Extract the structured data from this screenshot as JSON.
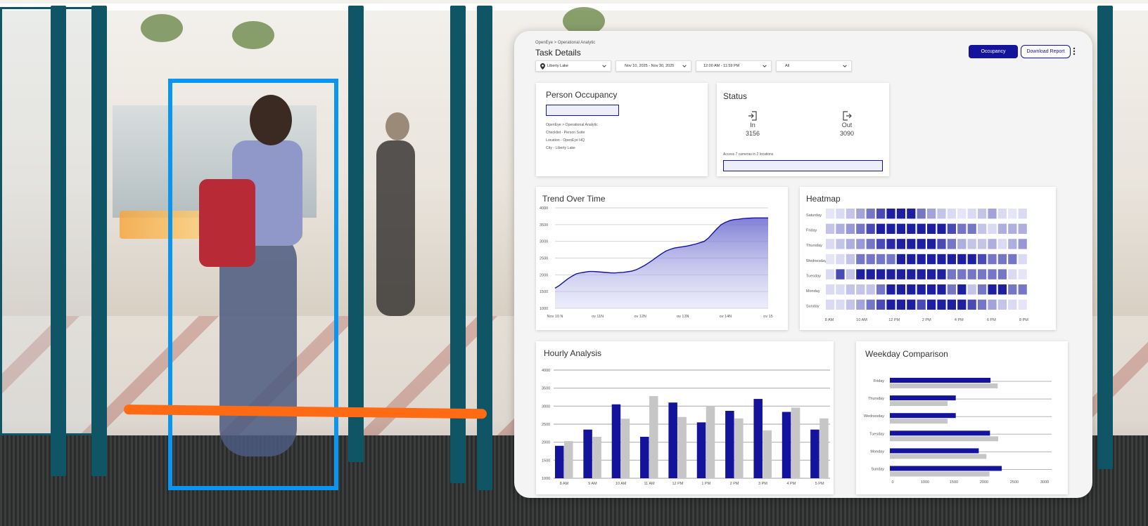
{
  "breadcrumb": "OpenEye  >  Operational Analytic",
  "page_title": "Task Details",
  "filters": {
    "location": "Liberty Lake",
    "date_range": "Nov 10, 2025 - Nov 30, 2025",
    "time_range": "12:00 AM - 11:59 PM",
    "camera": "All"
  },
  "buttons": {
    "occupancy": "Occupancy",
    "download": "Download Report"
  },
  "colors": {
    "accent": "#13139c",
    "detection_box": "#0a95f0",
    "counting_line": "#ff6a14"
  },
  "person_occupancy": {
    "title": "Person Occupancy",
    "lines": [
      "OpenEye  >  Operational Analytic",
      "Checklist - Person Suite",
      "Location - OpenEye HQ",
      "City - Liberty Lake"
    ]
  },
  "status": {
    "title": "Status",
    "in_label": "In",
    "in_value": "3156",
    "out_label": "Out",
    "out_value": "3090",
    "note": "Access 7 cameras in 2 locations"
  },
  "trend": {
    "title": "Trend Over Time",
    "chart_data": {
      "type": "area",
      "x_labels": [
        "Nov 10 N",
        "ov 11N",
        "ov 12N",
        "ov 13N",
        "ov 14N",
        "ov 15"
      ],
      "x": [
        0,
        0.1,
        0.2,
        0.3,
        0.4,
        0.5,
        0.6,
        0.7,
        0.8,
        0.9,
        1.0,
        1.1,
        1.2,
        1.3,
        1.4,
        1.5,
        1.6,
        1.7,
        1.8,
        1.9,
        2.0,
        2.1,
        2.2,
        2.3,
        2.4,
        2.5,
        2.6,
        2.7,
        2.8,
        2.9,
        3.0,
        3.1,
        3.2,
        3.3,
        3.4,
        3.5,
        3.6,
        3.7,
        3.8,
        3.9,
        4.0,
        4.1,
        4.2,
        4.3,
        4.4,
        4.5,
        4.6,
        4.7,
        4.8,
        4.9,
        5.0
      ],
      "y": [
        1600,
        1680,
        1780,
        1880,
        1960,
        2030,
        2060,
        2080,
        2100,
        2100,
        2090,
        2080,
        2070,
        2060,
        2055,
        2065,
        2075,
        2090,
        2110,
        2150,
        2210,
        2280,
        2360,
        2450,
        2540,
        2630,
        2710,
        2760,
        2800,
        2820,
        2840,
        2860,
        2890,
        2920,
        2960,
        3000,
        3100,
        3240,
        3380,
        3500,
        3570,
        3620,
        3650,
        3660,
        3680,
        3690,
        3695,
        3700,
        3700,
        3700,
        3700
      ],
      "y_ticks": [
        1000,
        1500,
        2000,
        2500,
        3000,
        3500,
        4000
      ],
      "ylim": [
        1000,
        4000
      ]
    }
  },
  "heatmap": {
    "title": "Heatmap",
    "chart_data": {
      "type": "heatmap",
      "rows": [
        "Saturday",
        "Friday",
        "Thursday",
        "Wednesday",
        "Tuesday",
        "Monday",
        "Sunday"
      ],
      "x_labels": [
        "8 AM",
        "10 AM",
        "12 PM",
        "2 PM",
        "4 PM",
        "6 PM",
        "8 PM"
      ],
      "values": [
        [
          0.05,
          0.1,
          0.2,
          0.35,
          0.55,
          0.75,
          0.95,
          0.95,
          0.95,
          0.55,
          0.35,
          0.2,
          0.1,
          0.05,
          0.1,
          0.2,
          0.35,
          0.1,
          0.05,
          0.1
        ],
        [
          0.2,
          0.3,
          0.4,
          0.55,
          0.75,
          0.95,
          0.95,
          0.95,
          0.95,
          0.95,
          0.95,
          0.95,
          0.75,
          0.55,
          0.55,
          0.2,
          0.1,
          0.3,
          0.3,
          0.3
        ],
        [
          0.1,
          0.2,
          0.3,
          0.4,
          0.55,
          0.75,
          0.9,
          0.95,
          0.95,
          0.95,
          0.95,
          0.75,
          0.55,
          0.3,
          0.2,
          0.2,
          0.3,
          0.1,
          0.3,
          0.4
        ],
        [
          0.05,
          0.1,
          0.2,
          0.55,
          0.55,
          0.55,
          0.55,
          0.95,
          0.95,
          0.95,
          0.95,
          0.95,
          0.95,
          0.95,
          0.95,
          0.75,
          0.55,
          0.55,
          0.55,
          0.1
        ],
        [
          0.1,
          0.75,
          0.2,
          0.95,
          0.95,
          0.95,
          0.95,
          0.95,
          0.95,
          0.95,
          0.95,
          0.95,
          0.55,
          0.55,
          0.55,
          0.55,
          0.55,
          0.55,
          0.1,
          0.05
        ],
        [
          0.1,
          0.1,
          0.2,
          0.2,
          0.2,
          0.55,
          0.95,
          0.95,
          0.95,
          0.95,
          0.95,
          0.95,
          0.55,
          0.95,
          0.2,
          0.55,
          0.95,
          0.95,
          0.55,
          0.55
        ],
        [
          0.1,
          0.1,
          0.2,
          0.35,
          0.55,
          0.75,
          0.95,
          0.95,
          0.95,
          0.75,
          0.95,
          0.95,
          0.95,
          0.95,
          0.75,
          0.55,
          0.35,
          0.2,
          0.1,
          0.05
        ]
      ]
    }
  },
  "hourly": {
    "title": "Hourly Analysis",
    "chart_data": {
      "type": "bar",
      "categories": [
        "8 AM",
        "9 AM",
        "10 AM",
        "11 AM",
        "12 PM",
        "1 PM",
        "2 PM",
        "3 PM",
        "4 PM",
        "5 PM"
      ],
      "series": [
        {
          "values": [
            1900,
            2350,
            3050,
            2150,
            3100,
            2550,
            2870,
            3200,
            2840,
            2350
          ]
        },
        {
          "values": [
            2030,
            2150,
            2650,
            3280,
            2700,
            3000,
            2660,
            2330,
            2960,
            2660
          ]
        }
      ],
      "y_ticks": [
        1000,
        1500,
        2000,
        2500,
        3000,
        3500,
        4000
      ],
      "ylim": [
        1000,
        4000
      ]
    }
  },
  "weekday": {
    "title": "Weekday Comparison",
    "chart_data": {
      "type": "bar",
      "orientation": "horizontal",
      "categories": [
        "Friday",
        "Thursday",
        "Wednesday",
        "Tuesday",
        "Monday",
        "Sunday"
      ],
      "series": [
        {
          "values": [
            1970,
            1290,
            1290,
            1960,
            1740,
            2190
          ]
        },
        {
          "values": [
            2110,
            1130,
            1130,
            2120,
            1890,
            1950
          ]
        }
      ],
      "x_ticks": [
        0,
        1000,
        1500,
        2000,
        2500,
        3000
      ]
    }
  }
}
